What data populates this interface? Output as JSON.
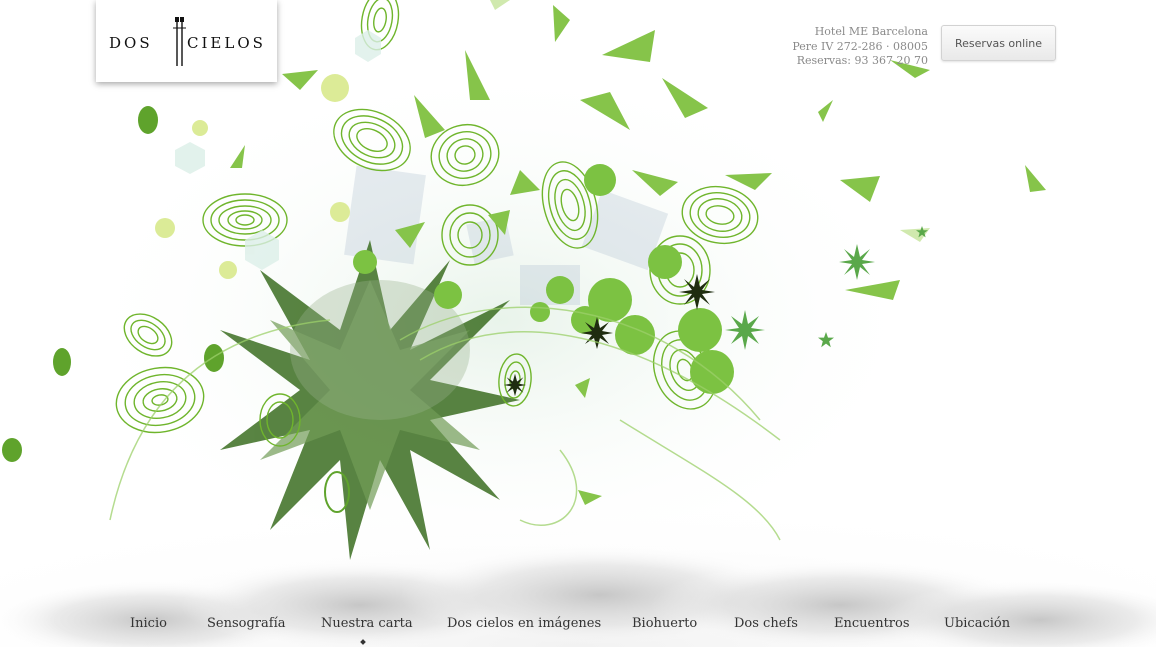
{
  "brand": {
    "logo_text_left": "DOS",
    "logo_text_right": "CIELOS"
  },
  "header": {
    "address_lines": [
      "Hotel ME Barcelona",
      "Pere IV 272-286 · 08005",
      "Reservas: 93 367 20 70"
    ],
    "reservas_button": "Reservas online"
  },
  "nav": {
    "items": [
      {
        "label": "Inicio"
      },
      {
        "label": "Sensografía"
      },
      {
        "label": "Nuestra carta"
      },
      {
        "label": "Dos cielos en imágenes"
      },
      {
        "label": "Biohuerto"
      },
      {
        "label": "Dos chefs"
      },
      {
        "label": "Encuentros"
      },
      {
        "label": "Ubicación"
      }
    ],
    "active_index": 2
  },
  "colors": {
    "accent_green": "#7cc242",
    "dark_green": "#3f7a20",
    "light_green": "#b8e07a",
    "text_gray": "#8a8a8a",
    "nav_text": "#333333"
  },
  "icons": {
    "prev": "chevron-left-icon",
    "next": "chevron-right-icon"
  }
}
